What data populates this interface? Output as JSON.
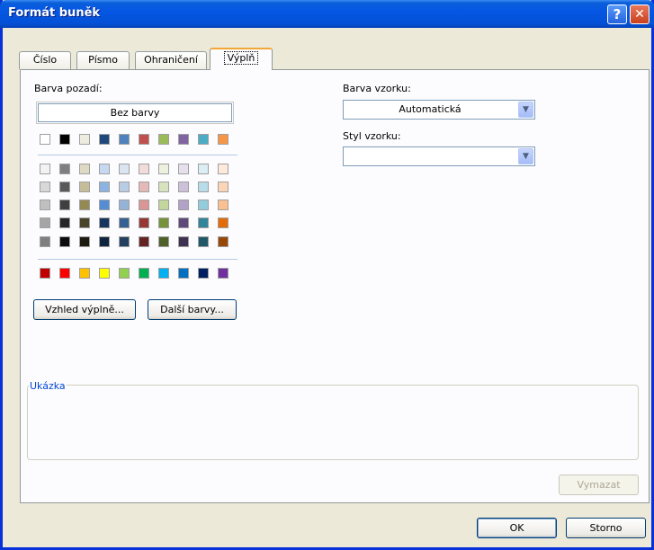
{
  "window": {
    "title": "Formát buněk"
  },
  "titlebar": {
    "help_glyph": "?",
    "close_glyph": "✕"
  },
  "tabs": [
    {
      "label": "Číslo"
    },
    {
      "label": "Písmo"
    },
    {
      "label": "Ohraničení"
    },
    {
      "label": "Výplň",
      "active": true
    }
  ],
  "fill": {
    "background_label": "Barva pozadí:",
    "no_color_label": "Bez barvy",
    "fill_effects_label": "Vzhled výplně...",
    "more_colors_label": "Další barvy...",
    "theme_top_row": [
      "#ffffff",
      "#000000",
      "#eeece1",
      "#1f497d",
      "#4f81bd",
      "#c0504d",
      "#9bbb59",
      "#8064a2",
      "#4bacc6",
      "#f79646"
    ],
    "theme_shades": [
      [
        "#f2f2f2",
        "#7f7f7f",
        "#ddd9c3",
        "#c6d9f0",
        "#dbe5f1",
        "#f2dcdb",
        "#ebf1dd",
        "#e5e0ec",
        "#dbeef3",
        "#fdeada"
      ],
      [
        "#d8d8d8",
        "#595959",
        "#c4bd97",
        "#8db3e2",
        "#b8cce4",
        "#e5b9b7",
        "#d7e3bc",
        "#ccc1d9",
        "#b7dde8",
        "#fbd5b5"
      ],
      [
        "#bfbfbf",
        "#3f3f3f",
        "#938953",
        "#548dd4",
        "#95b3d7",
        "#d99694",
        "#c3d69b",
        "#b2a2c7",
        "#92cddc",
        "#fac08f"
      ],
      [
        "#a5a5a5",
        "#262626",
        "#494429",
        "#17365d",
        "#366092",
        "#953734",
        "#76923c",
        "#5f497a",
        "#31859b",
        "#e36c09"
      ],
      [
        "#7f7f7f",
        "#0c0c0c",
        "#1d1b10",
        "#0f243e",
        "#244061",
        "#632423",
        "#4f6128",
        "#3f3151",
        "#205867",
        "#974806"
      ]
    ],
    "standard_colors": [
      "#c00000",
      "#ff0000",
      "#ffc000",
      "#ffff00",
      "#92d050",
      "#00b050",
      "#00b0f0",
      "#0070c0",
      "#002060",
      "#7030a0"
    ]
  },
  "pattern": {
    "color_label": "Barva vzorku:",
    "color_value": "Automatická",
    "style_label": "Styl vzorku:",
    "style_value": ""
  },
  "sample": {
    "group_label": "Ukázka"
  },
  "buttons": {
    "clear": "Vymazat",
    "ok": "OK",
    "cancel": "Storno"
  }
}
